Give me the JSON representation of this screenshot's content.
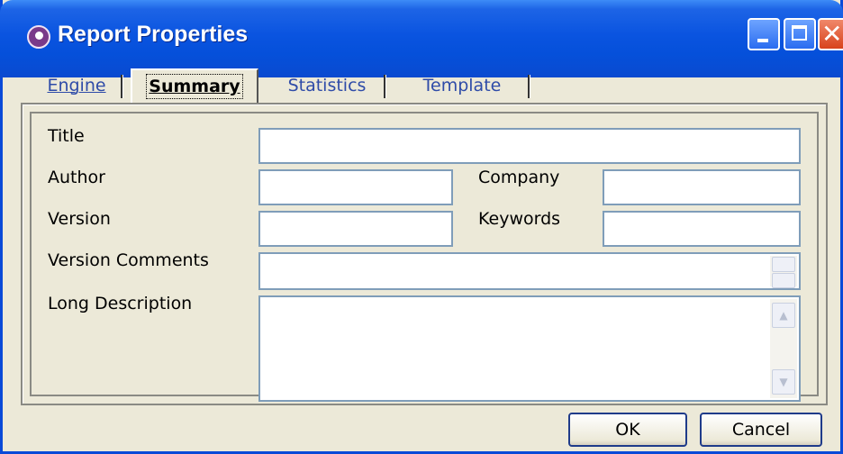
{
  "window": {
    "title": "Report Properties"
  },
  "tabs": [
    {
      "label": "Engine",
      "active": false
    },
    {
      "label": "Summary",
      "active": true
    },
    {
      "label": "Statistics",
      "active": false
    },
    {
      "label": "Template",
      "active": false
    }
  ],
  "form": {
    "title_label": "Title",
    "title_value": "",
    "author_label": "Author",
    "author_value": "",
    "company_label": "Company",
    "company_value": "",
    "version_label": "Version",
    "version_value": "",
    "keywords_label": "Keywords",
    "keywords_value": "",
    "version_comments_label": "Version Comments",
    "version_comments_value": "",
    "long_description_label": "Long Description",
    "long_description_value": ""
  },
  "buttons": {
    "ok": "OK",
    "cancel": "Cancel"
  },
  "icons": {
    "app": "report-app-icon",
    "minimize": "minimize-icon",
    "maximize": "maximize-icon",
    "close": "close-icon"
  },
  "colors": {
    "titlebar": "#0a54e0",
    "dialog_bg": "#ece9d8",
    "tab_text": "#2e4ba8",
    "field_border": "#7f9db9"
  }
}
